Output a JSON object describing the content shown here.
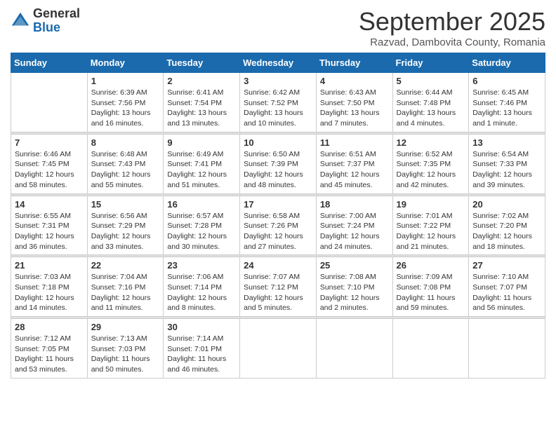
{
  "logo": {
    "general": "General",
    "blue": "Blue"
  },
  "header": {
    "month": "September 2025",
    "location": "Razvad, Dambovita County, Romania"
  },
  "weekdays": [
    "Sunday",
    "Monday",
    "Tuesday",
    "Wednesday",
    "Thursday",
    "Friday",
    "Saturday"
  ],
  "weeks": [
    [
      {
        "day": "",
        "info": ""
      },
      {
        "day": "1",
        "info": "Sunrise: 6:39 AM\nSunset: 7:56 PM\nDaylight: 13 hours\nand 16 minutes."
      },
      {
        "day": "2",
        "info": "Sunrise: 6:41 AM\nSunset: 7:54 PM\nDaylight: 13 hours\nand 13 minutes."
      },
      {
        "day": "3",
        "info": "Sunrise: 6:42 AM\nSunset: 7:52 PM\nDaylight: 13 hours\nand 10 minutes."
      },
      {
        "day": "4",
        "info": "Sunrise: 6:43 AM\nSunset: 7:50 PM\nDaylight: 13 hours\nand 7 minutes."
      },
      {
        "day": "5",
        "info": "Sunrise: 6:44 AM\nSunset: 7:48 PM\nDaylight: 13 hours\nand 4 minutes."
      },
      {
        "day": "6",
        "info": "Sunrise: 6:45 AM\nSunset: 7:46 PM\nDaylight: 13 hours\nand 1 minute."
      }
    ],
    [
      {
        "day": "7",
        "info": "Sunrise: 6:46 AM\nSunset: 7:45 PM\nDaylight: 12 hours\nand 58 minutes."
      },
      {
        "day": "8",
        "info": "Sunrise: 6:48 AM\nSunset: 7:43 PM\nDaylight: 12 hours\nand 55 minutes."
      },
      {
        "day": "9",
        "info": "Sunrise: 6:49 AM\nSunset: 7:41 PM\nDaylight: 12 hours\nand 51 minutes."
      },
      {
        "day": "10",
        "info": "Sunrise: 6:50 AM\nSunset: 7:39 PM\nDaylight: 12 hours\nand 48 minutes."
      },
      {
        "day": "11",
        "info": "Sunrise: 6:51 AM\nSunset: 7:37 PM\nDaylight: 12 hours\nand 45 minutes."
      },
      {
        "day": "12",
        "info": "Sunrise: 6:52 AM\nSunset: 7:35 PM\nDaylight: 12 hours\nand 42 minutes."
      },
      {
        "day": "13",
        "info": "Sunrise: 6:54 AM\nSunset: 7:33 PM\nDaylight: 12 hours\nand 39 minutes."
      }
    ],
    [
      {
        "day": "14",
        "info": "Sunrise: 6:55 AM\nSunset: 7:31 PM\nDaylight: 12 hours\nand 36 minutes."
      },
      {
        "day": "15",
        "info": "Sunrise: 6:56 AM\nSunset: 7:29 PM\nDaylight: 12 hours\nand 33 minutes."
      },
      {
        "day": "16",
        "info": "Sunrise: 6:57 AM\nSunset: 7:28 PM\nDaylight: 12 hours\nand 30 minutes."
      },
      {
        "day": "17",
        "info": "Sunrise: 6:58 AM\nSunset: 7:26 PM\nDaylight: 12 hours\nand 27 minutes."
      },
      {
        "day": "18",
        "info": "Sunrise: 7:00 AM\nSunset: 7:24 PM\nDaylight: 12 hours\nand 24 minutes."
      },
      {
        "day": "19",
        "info": "Sunrise: 7:01 AM\nSunset: 7:22 PM\nDaylight: 12 hours\nand 21 minutes."
      },
      {
        "day": "20",
        "info": "Sunrise: 7:02 AM\nSunset: 7:20 PM\nDaylight: 12 hours\nand 18 minutes."
      }
    ],
    [
      {
        "day": "21",
        "info": "Sunrise: 7:03 AM\nSunset: 7:18 PM\nDaylight: 12 hours\nand 14 minutes."
      },
      {
        "day": "22",
        "info": "Sunrise: 7:04 AM\nSunset: 7:16 PM\nDaylight: 12 hours\nand 11 minutes."
      },
      {
        "day": "23",
        "info": "Sunrise: 7:06 AM\nSunset: 7:14 PM\nDaylight: 12 hours\nand 8 minutes."
      },
      {
        "day": "24",
        "info": "Sunrise: 7:07 AM\nSunset: 7:12 PM\nDaylight: 12 hours\nand 5 minutes."
      },
      {
        "day": "25",
        "info": "Sunrise: 7:08 AM\nSunset: 7:10 PM\nDaylight: 12 hours\nand 2 minutes."
      },
      {
        "day": "26",
        "info": "Sunrise: 7:09 AM\nSunset: 7:08 PM\nDaylight: 11 hours\nand 59 minutes."
      },
      {
        "day": "27",
        "info": "Sunrise: 7:10 AM\nSunset: 7:07 PM\nDaylight: 11 hours\nand 56 minutes."
      }
    ],
    [
      {
        "day": "28",
        "info": "Sunrise: 7:12 AM\nSunset: 7:05 PM\nDaylight: 11 hours\nand 53 minutes."
      },
      {
        "day": "29",
        "info": "Sunrise: 7:13 AM\nSunset: 7:03 PM\nDaylight: 11 hours\nand 50 minutes."
      },
      {
        "day": "30",
        "info": "Sunrise: 7:14 AM\nSunset: 7:01 PM\nDaylight: 11 hours\nand 46 minutes."
      },
      {
        "day": "",
        "info": ""
      },
      {
        "day": "",
        "info": ""
      },
      {
        "day": "",
        "info": ""
      },
      {
        "day": "",
        "info": ""
      }
    ]
  ]
}
